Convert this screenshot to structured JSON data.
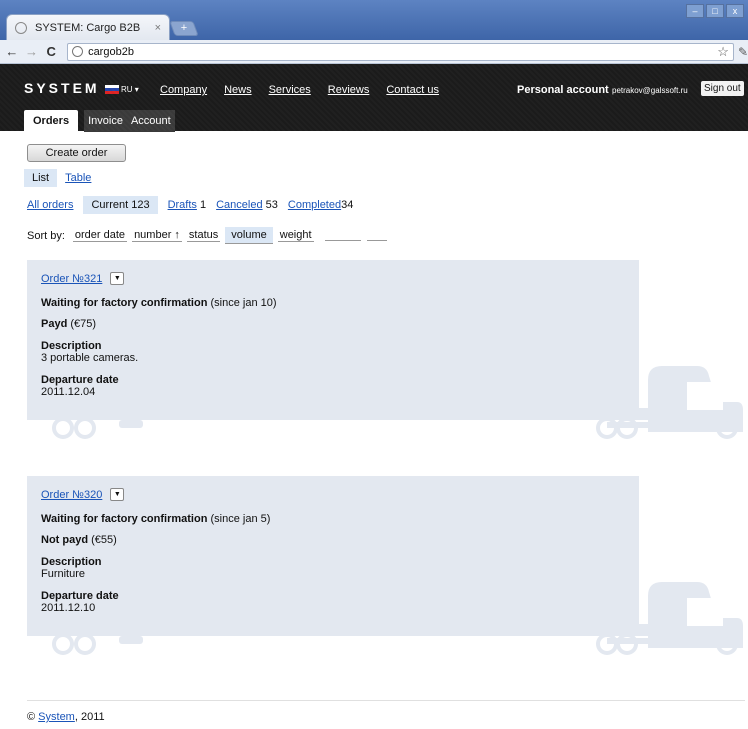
{
  "browser": {
    "tab_title": "SYSTEM: Cargo B2B",
    "tab_close": "×",
    "newtab_label": "+",
    "win_min": "–",
    "win_max": "□",
    "win_close": "x",
    "back": "←",
    "forward": "→",
    "reload": "C",
    "url": "cargob2b",
    "star": "☆",
    "wrench": "🔧"
  },
  "header": {
    "logo": "SYSTEM",
    "lang": "RU ▾",
    "nav": [
      "Company",
      "News",
      "Services",
      "Reviews",
      "Contact us"
    ],
    "account_label": "Personal account",
    "email": "petrakov@galssoft.ru",
    "signout": "Sign out",
    "subtabs": [
      "Orders",
      "Invoice",
      "Account"
    ]
  },
  "toolbar": {
    "create_order": "Create order",
    "view_list": "List",
    "view_table": "Table"
  },
  "filters": {
    "all": "All orders",
    "current_label": "Current",
    "current_count": "123",
    "drafts_label": "Drafts",
    "drafts_count": "1",
    "canceled_label": "Canceled",
    "canceled_count": "53",
    "completed_label": "Completed",
    "completed_count": "34"
  },
  "sort": {
    "label": "Sort by:",
    "options": [
      "order date",
      "number ↑",
      "status",
      "volume",
      "weight"
    ]
  },
  "orders": [
    {
      "number": "Order №321",
      "status_bold": "Waiting for factory confirmation",
      "status_rest": " (since jan 10)",
      "payment_bold": "Payd",
      "payment_rest": " (€75)",
      "desc_label": "Description",
      "desc": "3 portable cameras.",
      "dep_label": "Departure date",
      "dep": "2011.12.04"
    },
    {
      "number": "Order №320",
      "status_bold": "Waiting for factory confirmation",
      "status_rest": " (since jan 5)",
      "payment_bold": "Not payd",
      "payment_rest": " (€55)",
      "desc_label": "Description",
      "desc": "Furniture",
      "dep_label": "Departure date",
      "dep": "2011.12.10"
    }
  ],
  "footer": {
    "prefix": "© ",
    "link": "System",
    "suffix": ", 2011"
  },
  "colors": {
    "accent_link": "#1a54b8",
    "header_bg": "#1b1b1b",
    "card_bg": "#e3e8f0",
    "selected_bg": "#dbe7f5"
  }
}
